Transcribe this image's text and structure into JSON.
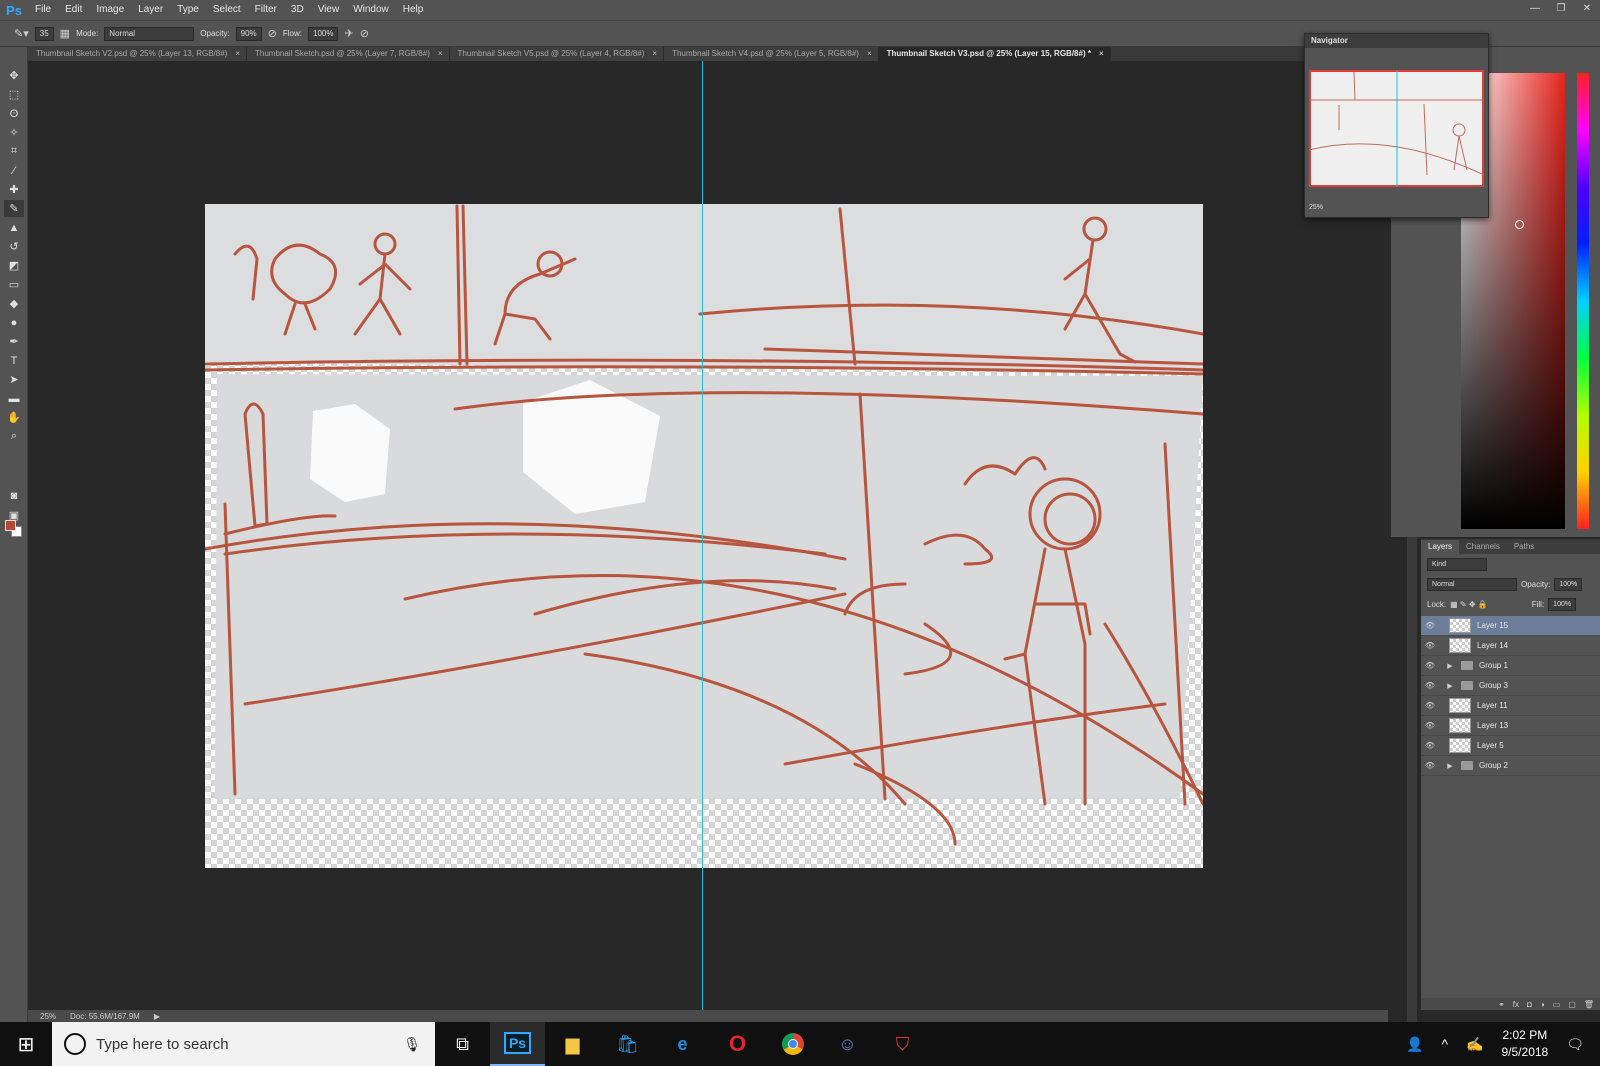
{
  "app": {
    "logo": "Ps"
  },
  "menu": [
    "File",
    "Edit",
    "Image",
    "Layer",
    "Type",
    "Select",
    "Filter",
    "3D",
    "View",
    "Window",
    "Help"
  ],
  "window_controls": [
    "—",
    "❐",
    "✕"
  ],
  "options": {
    "brush_size": "35",
    "mode_label": "Mode:",
    "mode_value": "Normal",
    "opacity_label": "Opacity:",
    "opacity_value": "90%",
    "flow_label": "Flow:",
    "flow_value": "100%"
  },
  "tabs": [
    {
      "label": "Thumbnail Sketch V2.psd @ 25% (Layer 13, RGB/8#)",
      "active": false
    },
    {
      "label": "Thumbnail Sketch.psd @ 25% (Layer 7, RGB/8#)",
      "active": false
    },
    {
      "label": "Thumbnail Sketch V5.psd @ 25% (Layer 4, RGB/8#)",
      "active": false
    },
    {
      "label": "Thumbnail Sketch V4.psd @ 25% (Layer 5, RGB/8#)",
      "active": false
    },
    {
      "label": "Thumbnail Sketch V3.psd @ 25% (Layer 15, RGB/8#) *",
      "active": true
    }
  ],
  "tab_close": "×",
  "status": {
    "zoom": "25%",
    "doc": "Doc: 55.6M/167.9M"
  },
  "navigator": {
    "title": "Navigator",
    "zoom": "25%"
  },
  "layers_panel": {
    "tabs": [
      "Layers",
      "Channels",
      "Paths"
    ],
    "kind": "Kind",
    "blend_mode": "Normal",
    "opacity_label": "Opacity:",
    "opacity_value": "100%",
    "lock_label": "Lock:",
    "fill_label": "Fill:",
    "fill_value": "100%",
    "layers": [
      {
        "name": "Layer 15",
        "type": "layer",
        "selected": true
      },
      {
        "name": "Layer 14",
        "type": "layer",
        "selected": false
      },
      {
        "name": "Group 1",
        "type": "group",
        "selected": false
      },
      {
        "name": "Group 3",
        "type": "group",
        "selected": false
      },
      {
        "name": "Layer 11",
        "type": "layer",
        "selected": false
      },
      {
        "name": "Layer 13",
        "type": "layer",
        "selected": false
      },
      {
        "name": "Layer 5",
        "type": "layer",
        "selected": false
      },
      {
        "name": "Group 2",
        "type": "group",
        "selected": false
      }
    ]
  },
  "taskbar": {
    "search_placeholder": "Type here to search",
    "time": "2:02 PM",
    "date": "9/5/2018"
  },
  "colors": {
    "sketch": "#b8553f",
    "paper": "#d9dadc",
    "guide": "#19c3d8",
    "foreground": "#b24b35"
  }
}
